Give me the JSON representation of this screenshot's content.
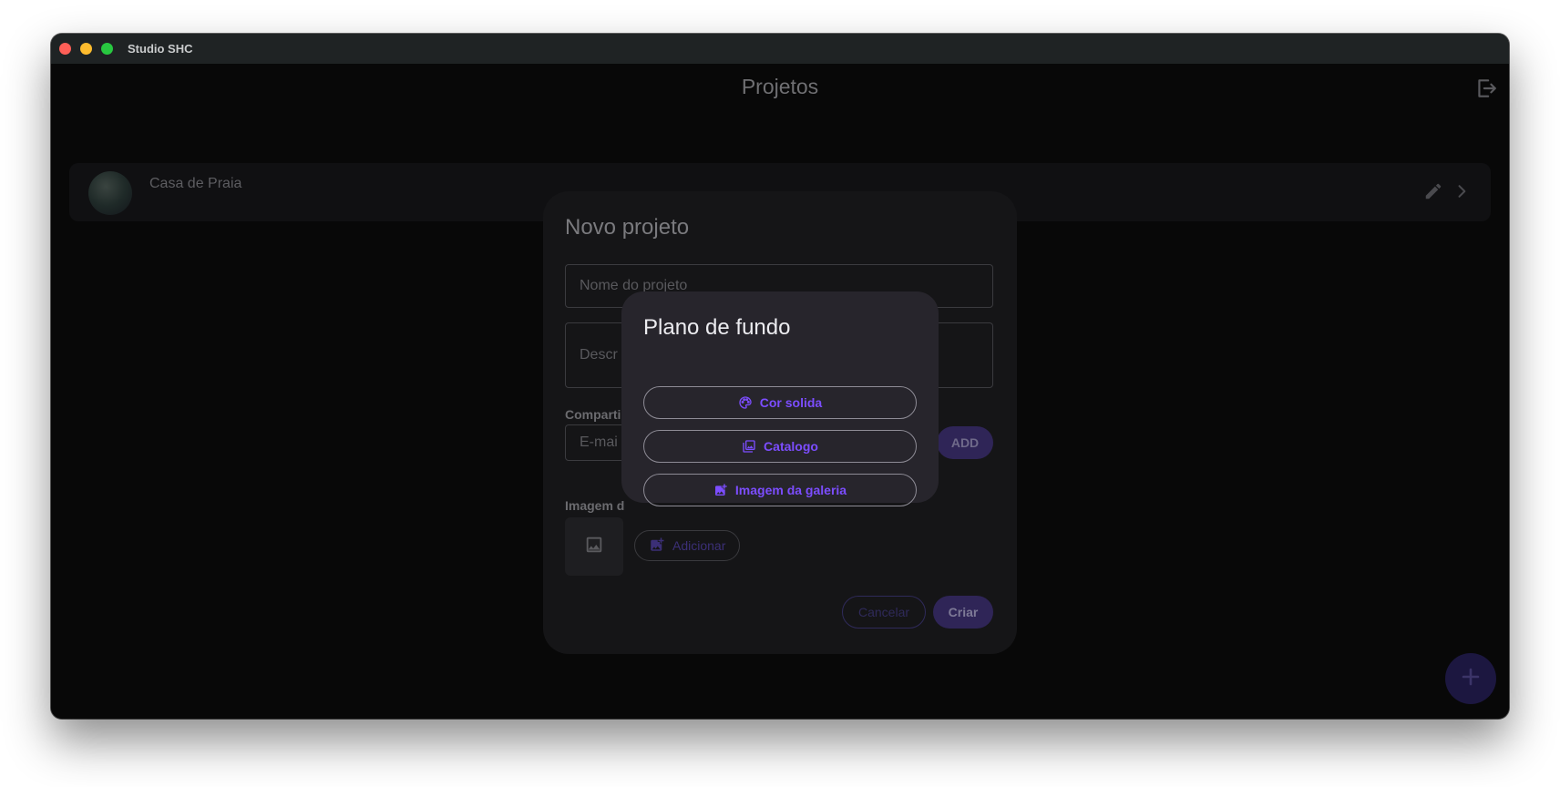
{
  "window": {
    "title": "Studio SHC"
  },
  "page": {
    "title": "Projetos"
  },
  "projects": [
    {
      "name": "Casa de Praia"
    }
  ],
  "new_project_dialog": {
    "title": "Novo projeto",
    "name_placeholder": "Nome do projeto",
    "description_placeholder": "Descr",
    "share_label": "Comparti",
    "email_placeholder": "E-mai",
    "add_label": "ADD",
    "image_label": "Imagem d",
    "add_image_label": "Adicionar",
    "cancel_label": "Cancelar",
    "create_label": "Criar"
  },
  "background_popup": {
    "title": "Plano de fundo",
    "options": [
      {
        "label": "Cor solida",
        "icon": "palette-icon"
      },
      {
        "label": "Catalogo",
        "icon": "photo-library-icon"
      },
      {
        "label": "Imagem da galeria",
        "icon": "add-photo-icon"
      }
    ]
  },
  "colors": {
    "accent": "#7c4dff",
    "window_bg": "#080808",
    "popup_bg": "#27252c",
    "titlebar_bg": "#1f2324"
  }
}
